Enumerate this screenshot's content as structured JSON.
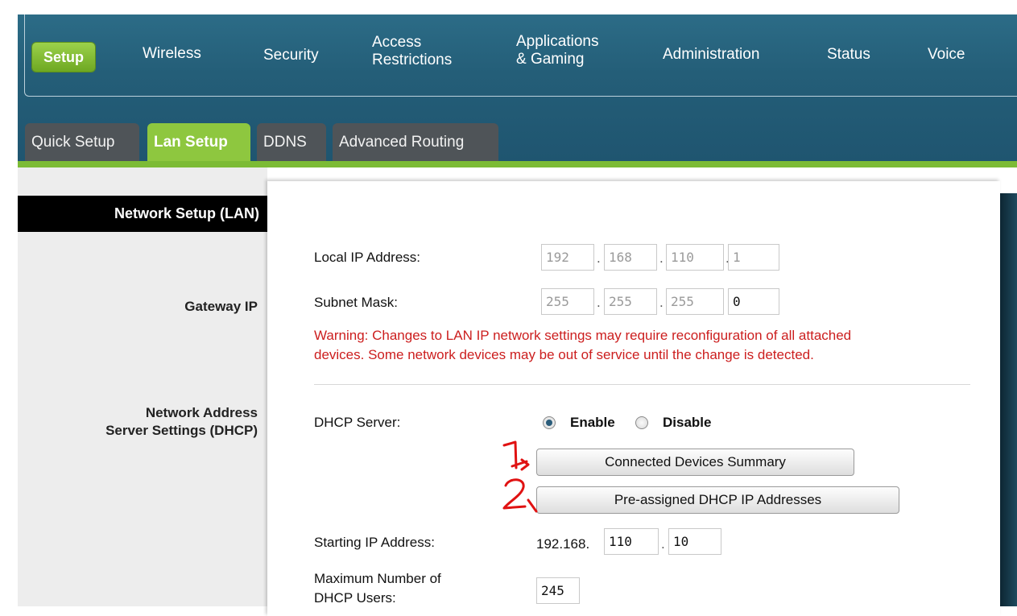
{
  "nav": {
    "items": [
      "Setup",
      "Wireless",
      "Security",
      "Access\nRestrictions",
      "Applications\n& Gaming",
      "Administration",
      "Status",
      "Voice"
    ]
  },
  "subtabs": [
    "Quick Setup",
    "Lan Setup",
    "DDNS",
    "Advanced Routing"
  ],
  "left": {
    "section_title": "Network Setup (LAN)",
    "gateway_label": "Gateway IP",
    "dhcp_label_1": "Network Address",
    "dhcp_label_2": "Server Settings (DHCP)"
  },
  "form": {
    "local_ip_label": "Local IP Address:",
    "local_ip": [
      "192",
      "168",
      "110",
      "1"
    ],
    "subnet_label": "Subnet Mask:",
    "subnet": [
      "255",
      "255",
      "255",
      "0"
    ],
    "warning_1": "Warning: Changes to LAN IP network settings may require reconfiguration of all attached",
    "warning_2": "devices. Some network devices may be out of service until the change is detected.",
    "dhcp_label": "DHCP Server:",
    "enable_label": "Enable",
    "disable_label": "Disable",
    "connected_btn": "Connected Devices Summary",
    "preassigned_btn": "Pre-assigned DHCP IP Addresses",
    "start_ip_label": "Starting IP Address:",
    "start_ip_prefix": "192.168.",
    "start_ip": [
      "110",
      "10"
    ],
    "max_users_label_1": "Maximum Number of",
    "max_users_label_2": "DHCP Users:",
    "max_users": "245"
  },
  "annotations": [
    "1",
    "2"
  ],
  "colors": {
    "accent_green": "#8ec73f",
    "header_blue": "#245e78",
    "warning_red": "#cc1e1e"
  }
}
